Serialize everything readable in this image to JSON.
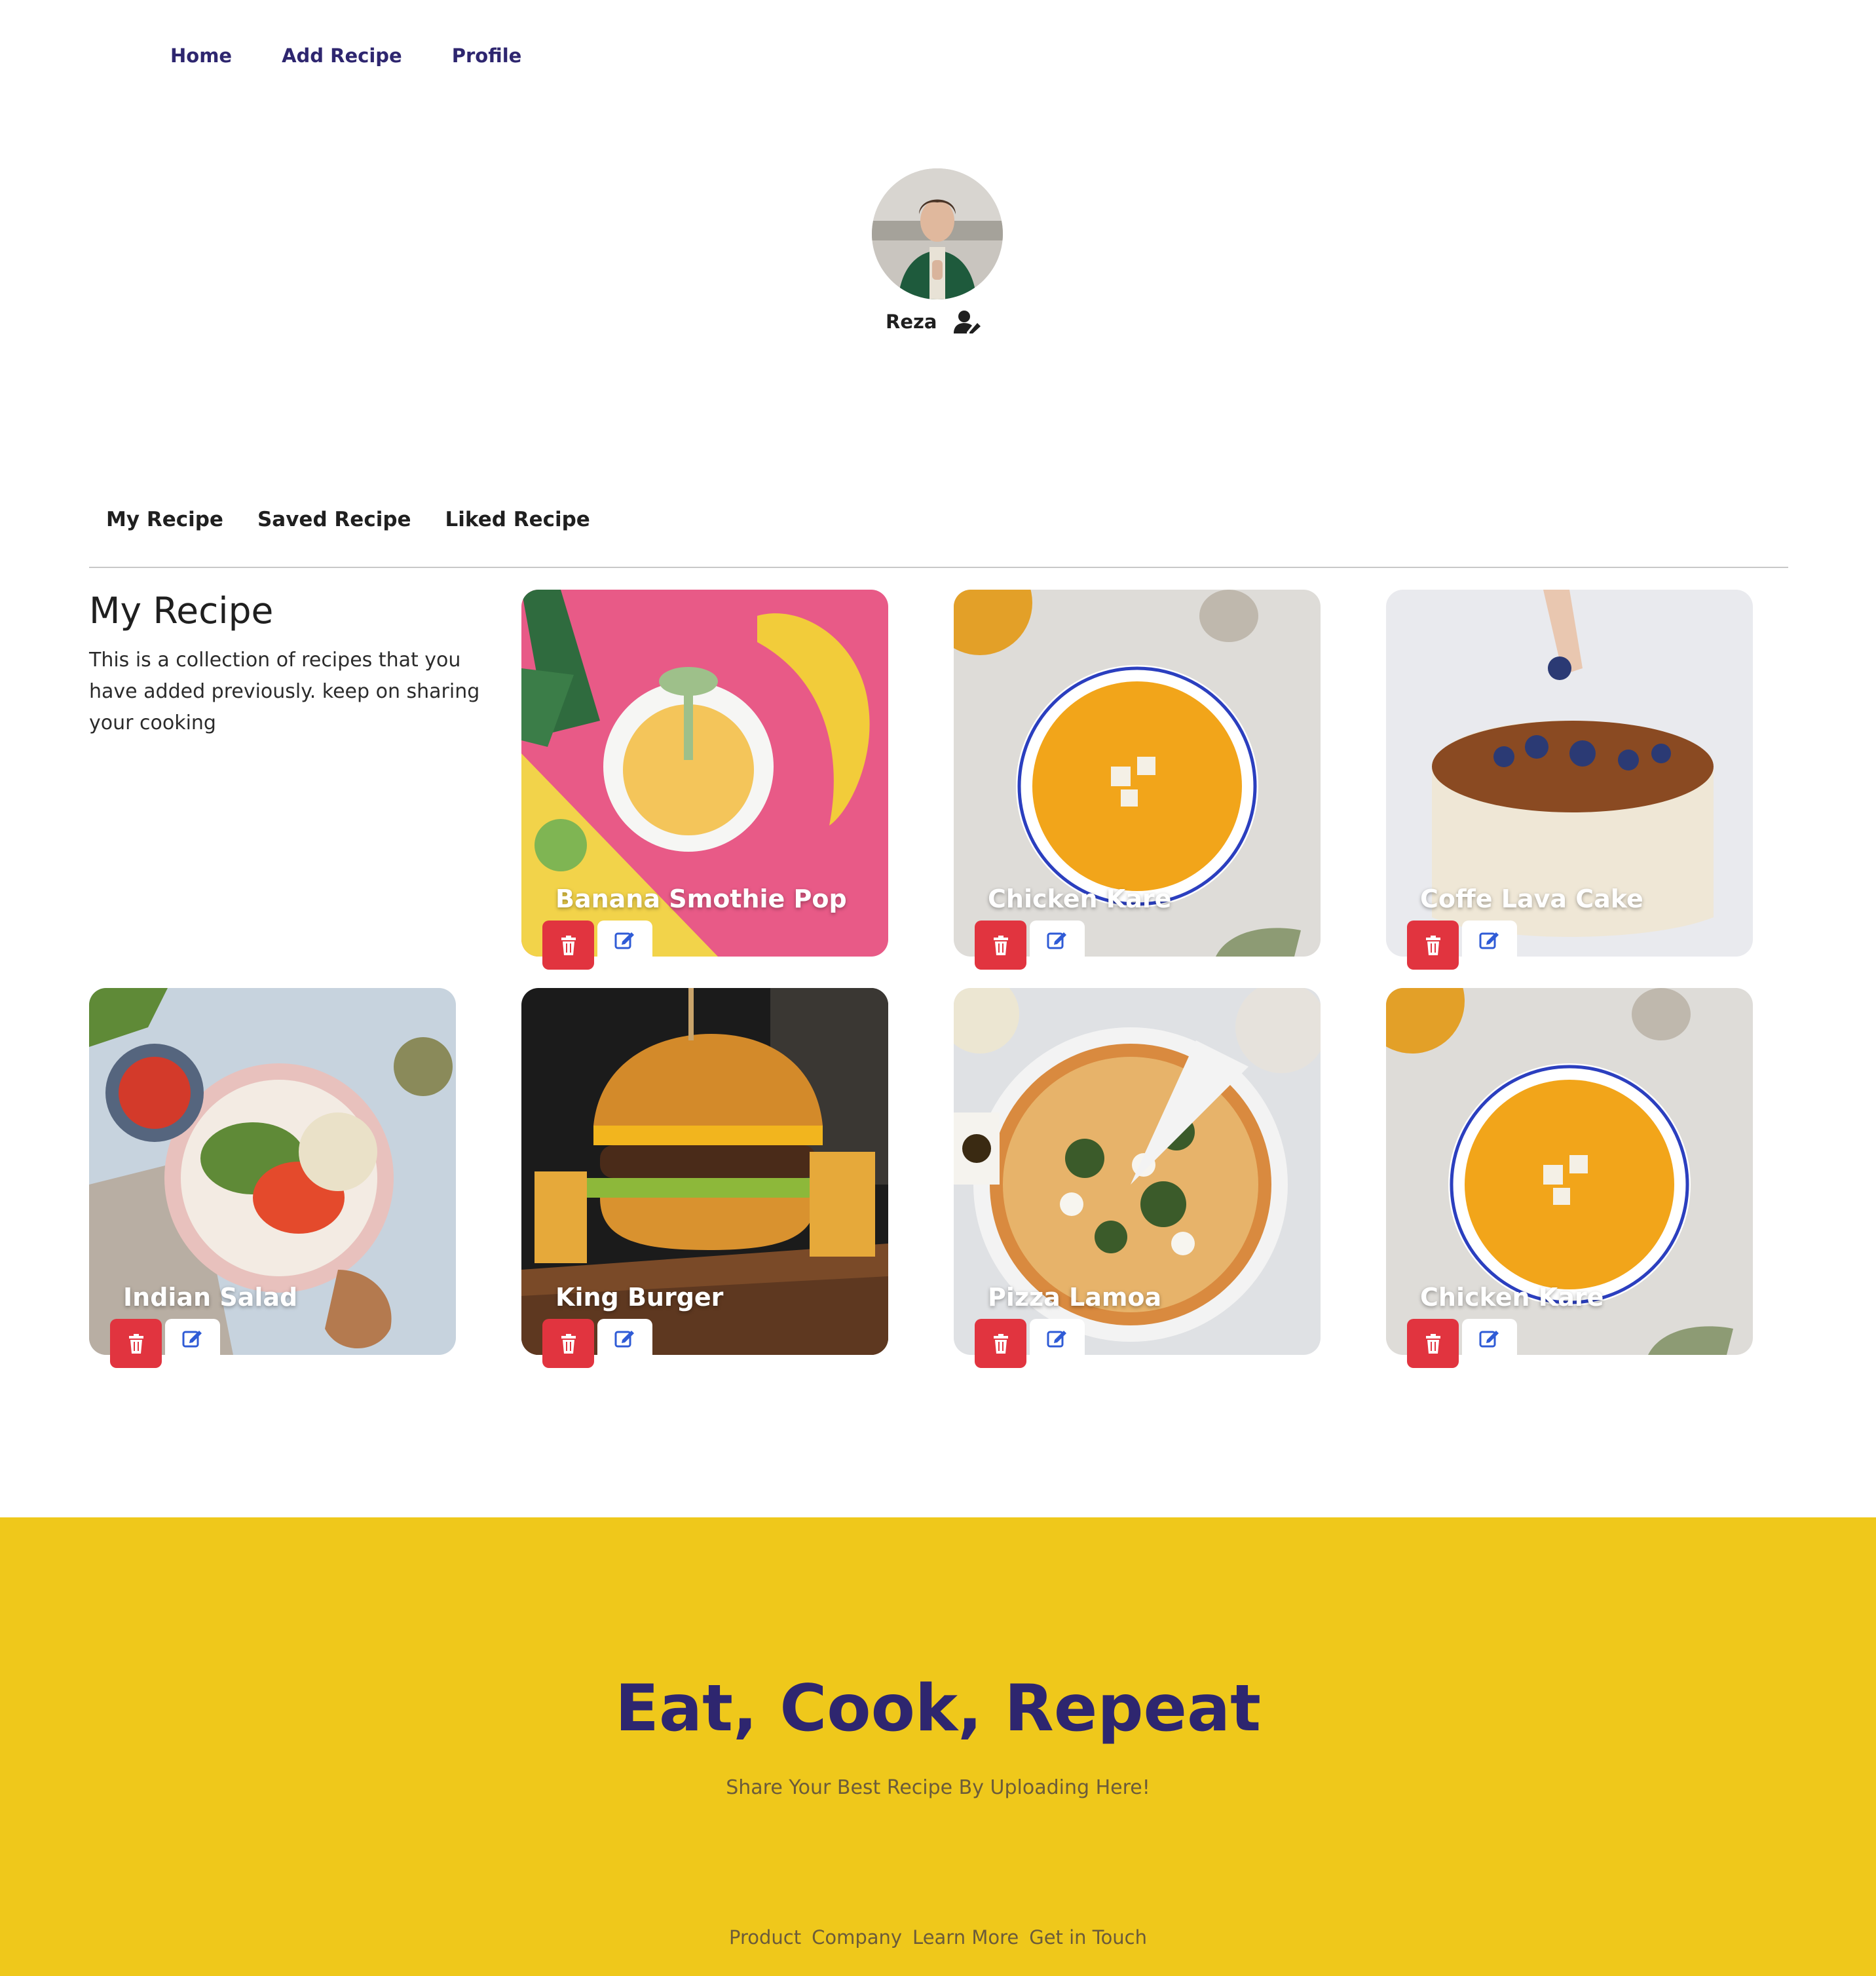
{
  "nav": {
    "items": [
      {
        "label": "Home"
      },
      {
        "label": "Add Recipe"
      },
      {
        "label": "Profile"
      }
    ]
  },
  "profile": {
    "name": "Reza",
    "edit_icon": "user-edit-icon"
  },
  "tabs": [
    {
      "label": "My Recipe"
    },
    {
      "label": "Saved Recipe"
    },
    {
      "label": "Liked Recipe"
    }
  ],
  "intro": {
    "title": "My Recipe",
    "text": "This is a collection of recipes that you have added previously. keep on sharing your cooking"
  },
  "recipes": [
    {
      "title": "Banana Smothie Pop"
    },
    {
      "title": "Chicken Kare"
    },
    {
      "title": "Coffe Lava Cake"
    },
    {
      "title": "Indian Salad"
    },
    {
      "title": "King Burger"
    },
    {
      "title": "Pizza Lamoa"
    },
    {
      "title": "Chicken Kare"
    }
  ],
  "card_actions": {
    "delete_icon": "trash-icon",
    "edit_icon": "edit-icon",
    "delete_color": "#e1343f"
  },
  "footer": {
    "title": "Eat, Cook, Repeat",
    "subtitle": "Share Your Best Recipe By Uploading Here!",
    "links": [
      {
        "label": "Product"
      },
      {
        "label": "Company"
      },
      {
        "label": "Learn More"
      },
      {
        "label": "Get in Touch"
      }
    ],
    "background": "#efc81b"
  },
  "colors": {
    "brand": "#2e266f",
    "accent": "#efc81b"
  }
}
